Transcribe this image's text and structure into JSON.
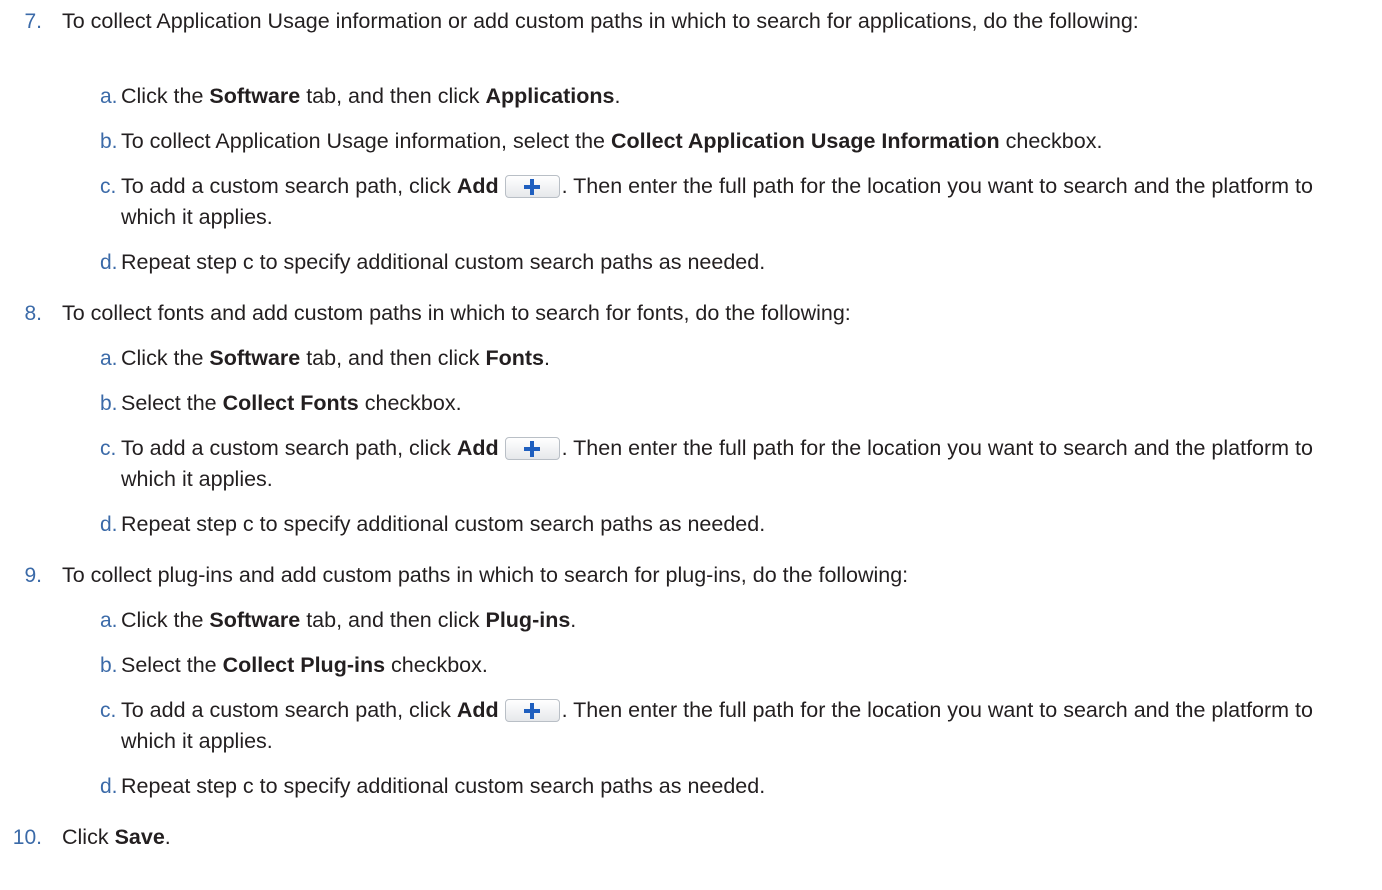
{
  "steps": [
    {
      "num": "7.",
      "text": "To collect Application Usage information or add custom paths in which to search for applications, do the following:",
      "subs": [
        {
          "letter": "a.",
          "p1": "Click the ",
          "b1": "Software",
          "p2": " tab, and then click ",
          "b2": "Applications",
          "p3": "."
        },
        {
          "letter": "b.",
          "p1": "To collect Application Usage information, select the ",
          "b1": "Collect Application Usage Information",
          "p2": " checkbox."
        },
        {
          "letter": "c.",
          "p1": "To add a custom search path, click ",
          "b1": "Add",
          "p2": ". Then enter the full path for the location you want to search and the platform to which it applies."
        },
        {
          "letter": "d.",
          "p1": "Repeat step c to specify additional custom search paths as needed."
        }
      ]
    },
    {
      "num": "8.",
      "text": "To collect fonts and add custom paths in which to search for fonts, do the following:",
      "subs": [
        {
          "letter": "a.",
          "p1": "Click the ",
          "b1": "Software",
          "p2": " tab, and then click ",
          "b2": "Fonts",
          "p3": "."
        },
        {
          "letter": "b.",
          "p1": "Select the ",
          "b1": "Collect Fonts",
          "p2": " checkbox."
        },
        {
          "letter": "c.",
          "p1": "To add a custom search path, click ",
          "b1": "Add",
          "p2": ". Then enter the full path for the location you want to search and the platform to which it applies."
        },
        {
          "letter": "d.",
          "p1": "Repeat step c to specify additional custom search paths as needed."
        }
      ]
    },
    {
      "num": "9.",
      "text": "To collect plug-ins and add custom paths in which to search for plug-ins, do the following:",
      "subs": [
        {
          "letter": "a.",
          "p1": "Click the ",
          "b1": "Software",
          "p2": " tab, and then click ",
          "b2": "Plug-ins",
          "p3": "."
        },
        {
          "letter": "b.",
          "p1": "Select the ",
          "b1": "Collect Plug-ins",
          "p2": " checkbox."
        },
        {
          "letter": "c.",
          "p1": "To add a custom search path, click ",
          "b1": "Add",
          "p2": ". Then enter the full path for the location you want to search and the platform to which it applies."
        },
        {
          "letter": "d.",
          "p1": "Repeat step c to specify additional custom search paths as needed."
        }
      ]
    },
    {
      "num": "10.",
      "p1": "Click ",
      "b1": "Save",
      "p2": "."
    }
  ],
  "icons": {
    "add": "plus-icon",
    "accent": "#3b6aa8",
    "plus_color": "#1f5fbf"
  }
}
